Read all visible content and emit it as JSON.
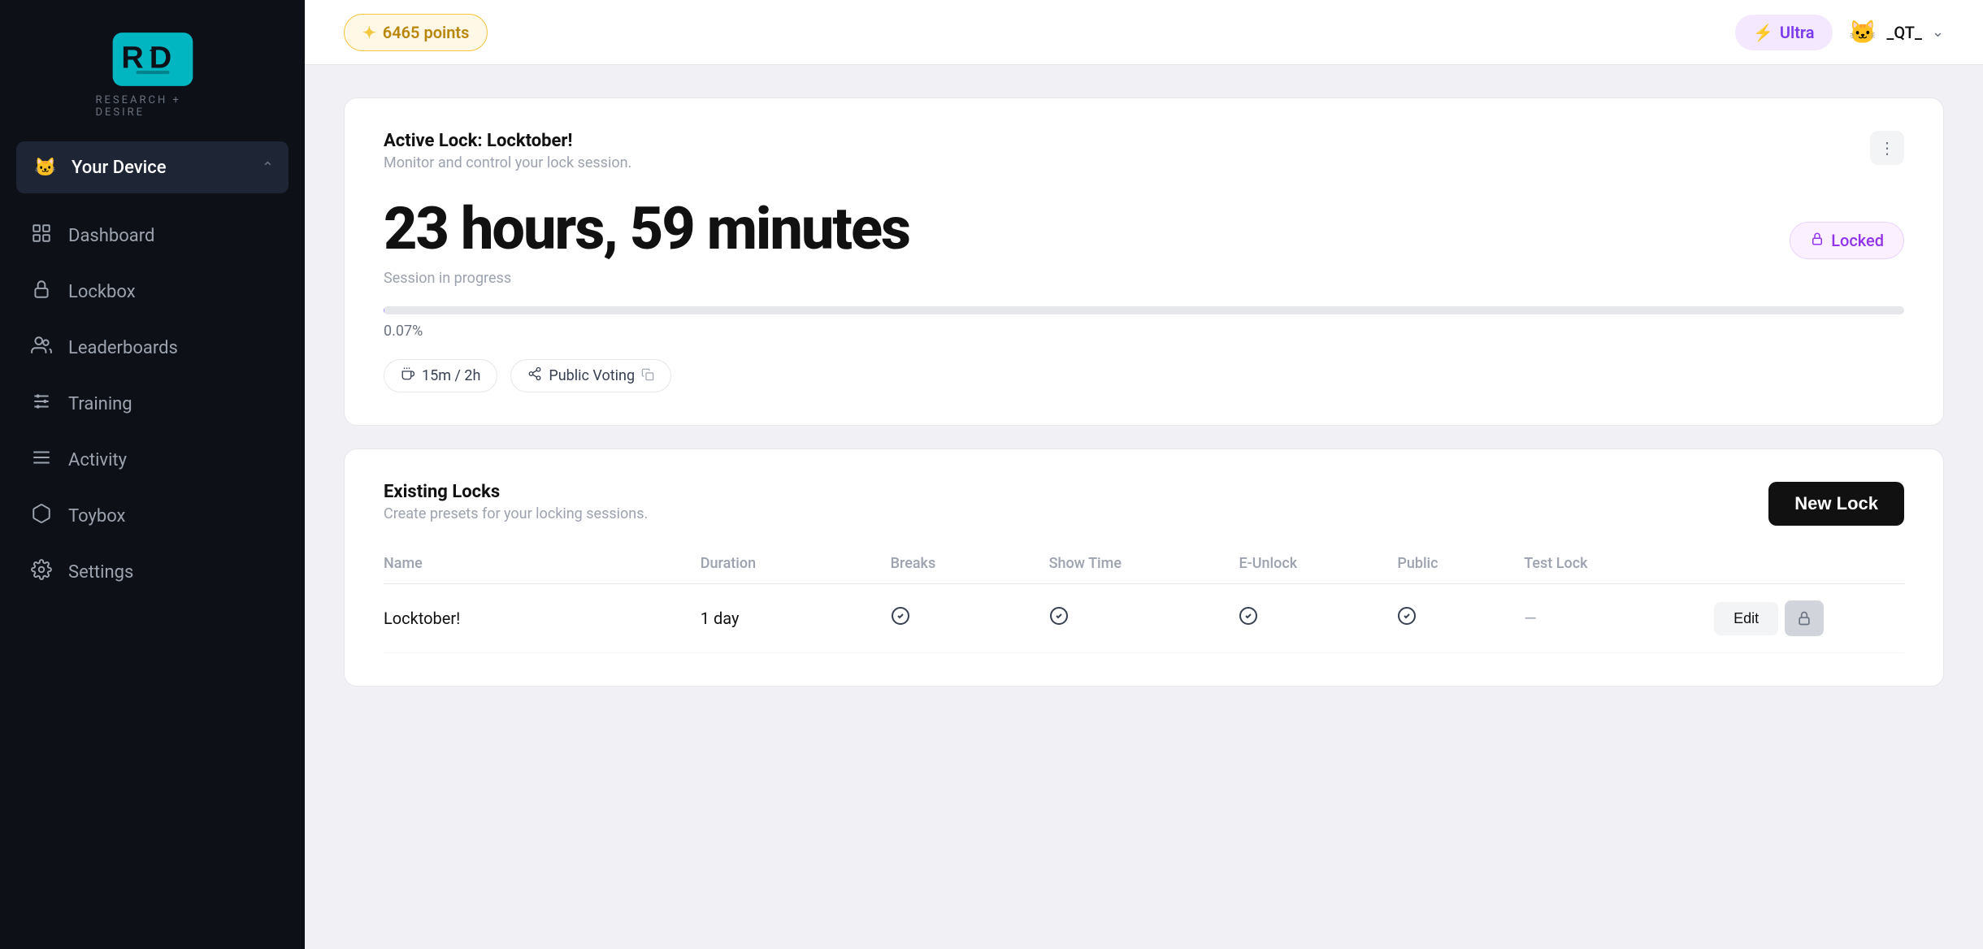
{
  "sidebar": {
    "logo_text": "RESEARCH + DESIRE",
    "device": {
      "name": "Your Device",
      "chevron": "⌃"
    },
    "nav_items": [
      {
        "id": "dashboard",
        "label": "Dashboard",
        "icon": "👥"
      },
      {
        "id": "lockbox",
        "label": "Lockbox",
        "icon": "🔒"
      },
      {
        "id": "leaderboards",
        "label": "Leaderboards",
        "icon": "👥"
      },
      {
        "id": "training",
        "label": "Training",
        "icon": "⚙"
      },
      {
        "id": "activity",
        "label": "Activity",
        "icon": "≡"
      },
      {
        "id": "toybox",
        "label": "Toybox",
        "icon": "◻"
      },
      {
        "id": "settings",
        "label": "Settings",
        "icon": "⚙"
      }
    ]
  },
  "topbar": {
    "points": "6465 points",
    "points_icon": "✦",
    "ultra_label": "Ultra",
    "ultra_icon": "⚡",
    "user_avatar": "🐱",
    "user_name": "_QT_",
    "user_chevron": "⌄"
  },
  "active_lock": {
    "title": "Active Lock: Locktober!",
    "subtitle": "Monitor and control your lock session.",
    "timer": "23 hours, 59 minutes",
    "session_label": "Session in progress",
    "progress_percent": "0.07%",
    "progress_value": 0.07,
    "locked_label": "Locked",
    "locked_icon": "🔒",
    "tags": [
      {
        "id": "hygiene",
        "label": "15m / 2h",
        "icon": "☕"
      },
      {
        "id": "voting",
        "label": "Public Voting",
        "icon": "⇄",
        "copy": true
      }
    ],
    "more_icon": "⋮"
  },
  "existing_locks": {
    "title": "Existing Locks",
    "subtitle": "Create presets for your locking sessions.",
    "new_lock_label": "New Lock",
    "table_headers": [
      "Name",
      "Duration",
      "Breaks",
      "Show Time",
      "E-Unlock",
      "Public",
      "Test Lock",
      ""
    ],
    "rows": [
      {
        "name": "Locktober!",
        "duration": "1 day",
        "breaks": true,
        "show_time": true,
        "e_unlock": true,
        "public": true,
        "test_lock": false,
        "edit_label": "Edit",
        "lock_icon": "🔒"
      }
    ]
  }
}
